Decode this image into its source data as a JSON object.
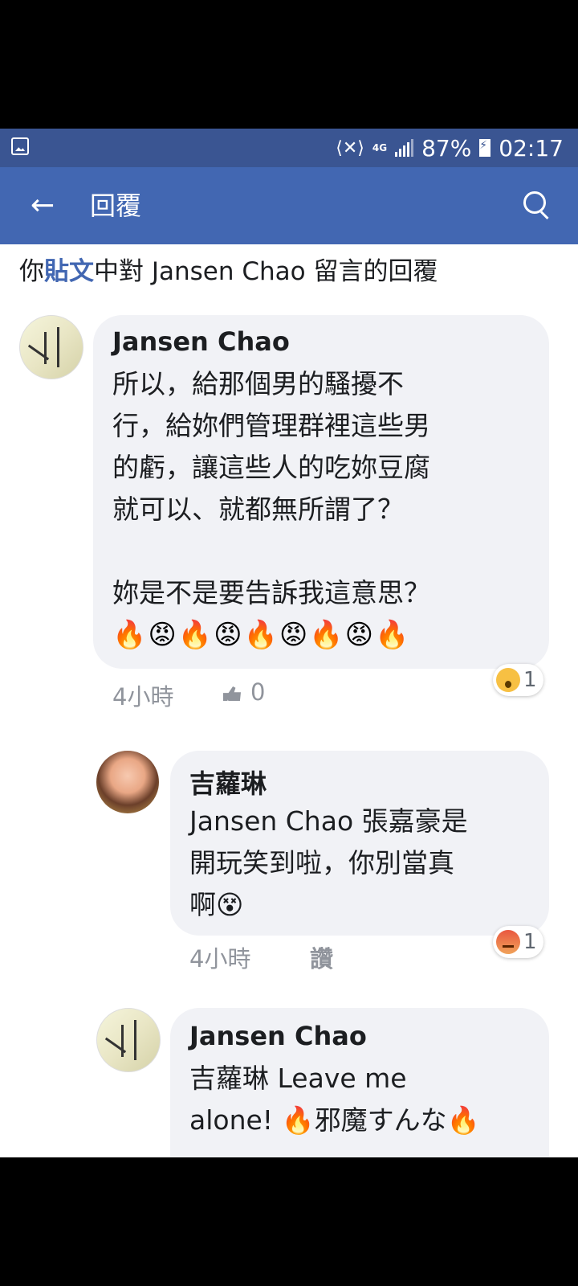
{
  "status_bar": {
    "battery": "87%",
    "time": "02:17",
    "network": "4G",
    "vibrate_icon": "vibrate-mute-icon",
    "signal_icon": "signal-icon",
    "battery_icon": "battery-charging-icon",
    "gallery_icon": "image-icon"
  },
  "app_bar": {
    "title": "回覆",
    "back_icon": "back-arrow-icon",
    "search_icon": "search-icon",
    "color": "#4267b2"
  },
  "header": {
    "prefix": "你",
    "link": "貼文",
    "suffix": "中對 Jansen Chao 留言的回覆"
  },
  "comments": [
    {
      "author": "Jansen Chao",
      "text": "所以，給那個男的騷擾不\n行，給妳們管理群裡這些男\n的虧，讓這些人的吃妳豆腐\n就可以、就都無所謂了？\n\n妳是不是要告訴我這意思？",
      "emoji_line": "🔥😡🔥😡🔥😡🔥😡🔥",
      "time": "4小時",
      "like_count": "0",
      "reaction": {
        "icon": "wow-reaction-icon",
        "count": "1"
      }
    },
    {
      "author": "吉蘿琳",
      "text": "Jansen Chao 張嘉豪是\n開玩笑到啦，你別當真\n啊😵",
      "time": "4小時",
      "like_label": "讚",
      "reaction": {
        "icon": "angry-reaction-icon",
        "count": "1"
      }
    },
    {
      "author": "Jansen Chao",
      "text": "吉蘿琳 Leave me\nalone! 🔥邪魔すんな🔥"
    }
  ]
}
